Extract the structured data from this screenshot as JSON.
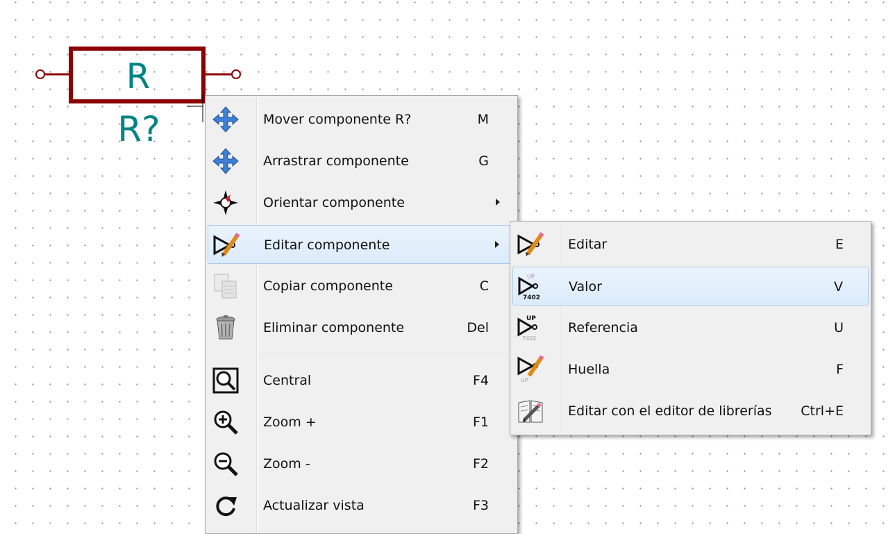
{
  "schematic": {
    "reference_label": "R",
    "value_label": "R?",
    "body_color": "#8b0000",
    "text_color": "#008484"
  },
  "main_menu": {
    "items": [
      {
        "label": "Mover componente R?",
        "shortcut": "M",
        "icon": "move-icon"
      },
      {
        "label": "Arrastrar componente",
        "shortcut": "G",
        "icon": "drag-icon"
      },
      {
        "label": "Orientar componente",
        "shortcut": "",
        "icon": "orient-icon",
        "submenu": true
      },
      {
        "label": "Editar componente",
        "shortcut": "",
        "icon": "edit-component-icon",
        "submenu": true,
        "highlighted": true
      },
      {
        "label": "Copiar componente",
        "shortcut": "C",
        "icon": "copy-icon"
      },
      {
        "label": "Eliminar componente",
        "shortcut": "Del",
        "icon": "trash-icon"
      },
      {
        "label": "Central",
        "shortcut": "F4",
        "icon": "zoom-center-icon"
      },
      {
        "label": "Zoom +",
        "shortcut": "F1",
        "icon": "zoom-in-icon"
      },
      {
        "label": "Zoom -",
        "shortcut": "F2",
        "icon": "zoom-out-icon"
      },
      {
        "label": "Actualizar vista",
        "shortcut": "F3",
        "icon": "refresh-icon"
      }
    ]
  },
  "sub_menu": {
    "items": [
      {
        "label": "Editar",
        "shortcut": "E",
        "icon": "edit-icon"
      },
      {
        "label": "Valor",
        "shortcut": "V",
        "icon": "value-icon",
        "highlighted": true
      },
      {
        "label": "Referencia",
        "shortcut": "U",
        "icon": "reference-icon"
      },
      {
        "label": "Huella",
        "shortcut": "F",
        "icon": "footprint-icon"
      },
      {
        "label": "Editar con el editor de librerías",
        "shortcut": "Ctrl+E",
        "icon": "library-editor-icon"
      }
    ],
    "icon_text": {
      "up": "UP",
      "part": "7402"
    }
  },
  "colors": {
    "highlight_bg": "#dcebfa",
    "highlight_border": "#a9cbe9",
    "menu_bg": "#f0f0f0"
  }
}
